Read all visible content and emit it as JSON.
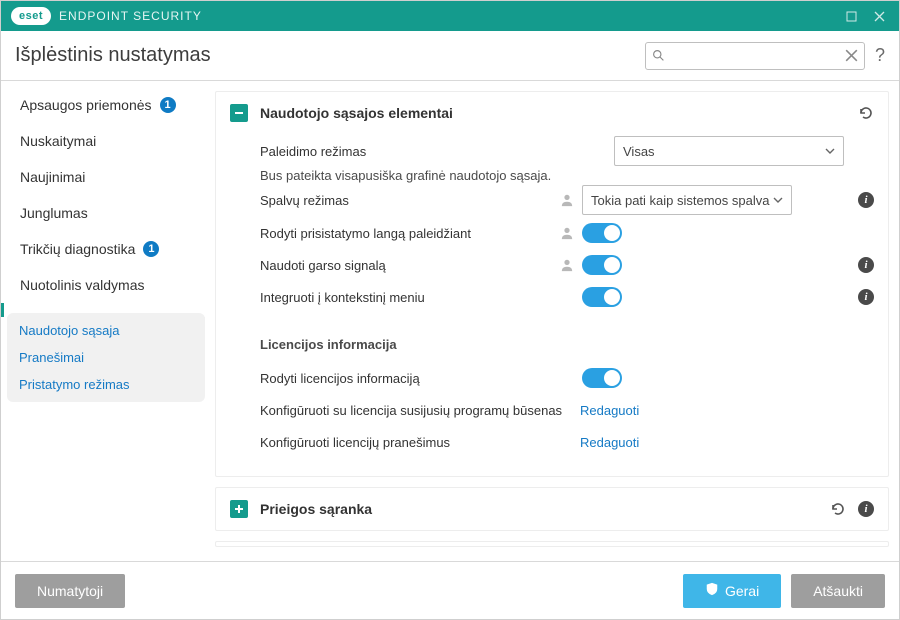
{
  "titlebar": {
    "brand": "eset",
    "product": "ENDPOINT SECURITY"
  },
  "header": {
    "title": "Išplėstinis nustatymas",
    "search_value": ""
  },
  "sidebar": {
    "items": [
      {
        "label": "Apsaugos priemonės",
        "badge": "1"
      },
      {
        "label": "Nuskaitymai"
      },
      {
        "label": "Naujinimai"
      },
      {
        "label": "Junglumas"
      },
      {
        "label": "Trikčių diagnostika",
        "badge": "1"
      },
      {
        "label": "Nuotolinis valdymas"
      },
      {
        "label": "Naudotojo sąsaja",
        "active": true
      }
    ],
    "subitems": [
      {
        "label": "Pranešimai"
      },
      {
        "label": "Pristatymo režimas"
      }
    ]
  },
  "panels": {
    "ui": {
      "title": "Naudotojo sąsajos elementai",
      "startup_mode": {
        "label": "Paleidimo režimas",
        "value": "Visas",
        "hint": "Bus pateikta visapusiška grafinė naudotojo sąsaja."
      },
      "color_mode": {
        "label": "Spalvų režimas",
        "value": "Tokia pati kaip sistemos spalva"
      },
      "splash": {
        "label": "Rodyti prisistatymo langą paleidžiant"
      },
      "sound": {
        "label": "Naudoti garso signalą"
      },
      "context": {
        "label": "Integruoti į kontekstinį meniu"
      },
      "license_section": "Licencijos informacija",
      "show_license": {
        "label": "Rodyti licencijos informaciją"
      },
      "config_states": {
        "label": "Konfigūruoti su licencija susijusių programų būsenas",
        "action": "Redaguoti"
      },
      "config_msgs": {
        "label": "Konfigūruoti licencijų pranešimus",
        "action": "Redaguoti"
      }
    },
    "access": {
      "title": "Prieigos sąranka"
    }
  },
  "footer": {
    "default": "Numatytoji",
    "ok": "Gerai",
    "cancel": "Atšaukti"
  }
}
